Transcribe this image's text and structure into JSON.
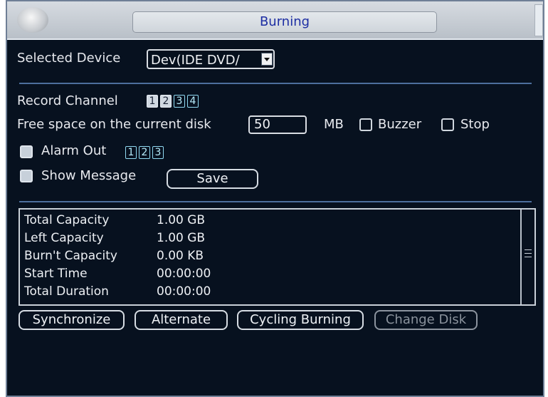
{
  "window": {
    "title": "Burning"
  },
  "device": {
    "label": "Selected Device",
    "value": "Dev(IDE DVD/"
  },
  "record_channel": {
    "label": "Record Channel",
    "channels": [
      "1",
      "2",
      "3",
      "4"
    ],
    "selected": [
      "1",
      "2"
    ]
  },
  "free_space": {
    "label": "Free space on the current disk",
    "value": "50",
    "unit": "MB"
  },
  "options": {
    "buzzer": "Buzzer",
    "stop": "Stop"
  },
  "alarm_out": {
    "label": "Alarm Out",
    "channels": [
      "1",
      "2",
      "3"
    ]
  },
  "show_message": {
    "label": "Show Message"
  },
  "buttons": {
    "save": "Save",
    "synchronize": "Synchronize",
    "alternate": "Alternate",
    "cycling": "Cycling Burning",
    "change_disk": "Change Disk"
  },
  "info": [
    {
      "label": "Total Capacity",
      "value": "1.00 GB"
    },
    {
      "label": "Left Capacity",
      "value": "1.00 GB"
    },
    {
      "label": "Burn't Capacity",
      "value": "0.00 KB"
    },
    {
      "label": "Start Time",
      "value": "00:00:00"
    },
    {
      "label": "Total Duration",
      "value": "00:00:00"
    }
  ]
}
